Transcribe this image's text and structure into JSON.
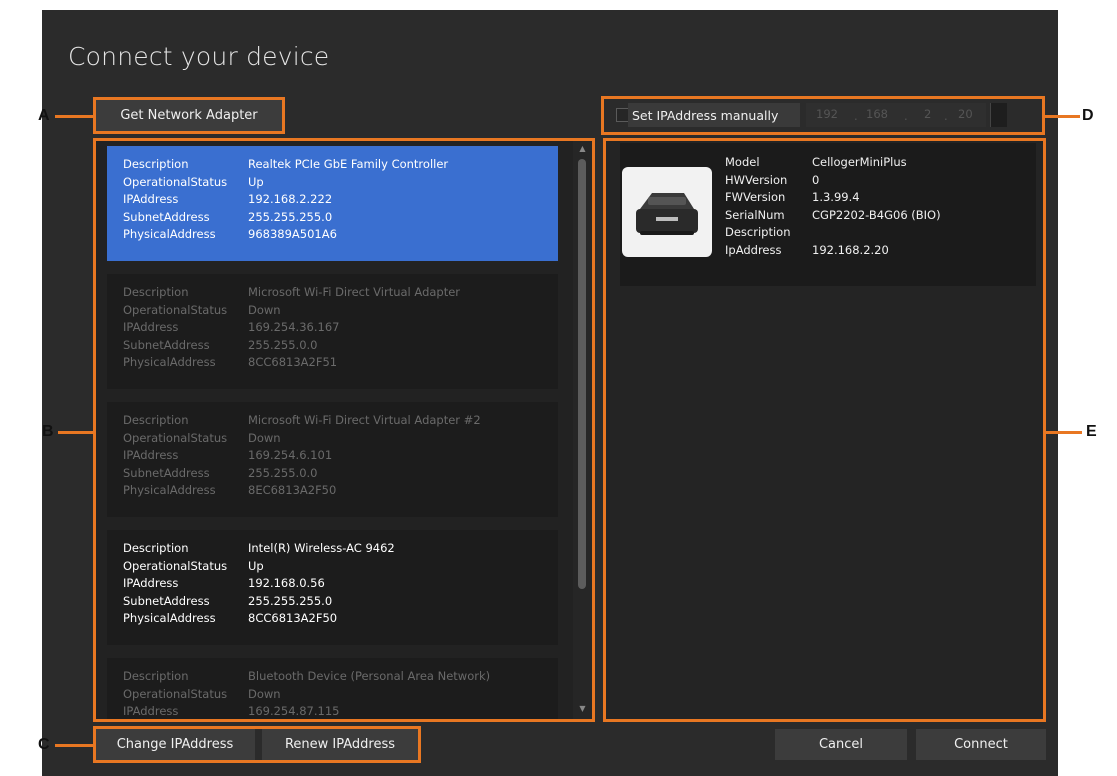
{
  "dialog": {
    "title": "Connect your device"
  },
  "buttons": {
    "get_network_adapter": "Get Network Adapter",
    "change_ip": "Change IPAddress",
    "renew_ip": "Renew IPAddress",
    "cancel": "Cancel",
    "connect": "Connect"
  },
  "callouts": {
    "a": "A",
    "b": "B",
    "c": "C",
    "d": "D",
    "e": "E"
  },
  "adapters": [
    {
      "description": "Realtek PCIe GbE Family Controller",
      "status": "Up",
      "ip": "192.168.2.222",
      "subnet": "255.255.255.0",
      "mac": "968389A501A6",
      "state": "selected"
    },
    {
      "description": "Microsoft Wi-Fi Direct Virtual Adapter",
      "status": "Down",
      "ip": "169.254.36.167",
      "subnet": "255.255.0.0",
      "mac": "8CC6813A2F51",
      "state": "dim"
    },
    {
      "description": "Microsoft Wi-Fi Direct Virtual Adapter #2",
      "status": "Down",
      "ip": "169.254.6.101",
      "subnet": "255.255.0.0",
      "mac": "8EC6813A2F50",
      "state": "dim"
    },
    {
      "description": "Intel(R) Wireless-AC 9462",
      "status": "Up",
      "ip": "192.168.0.56",
      "subnet": "255.255.255.0",
      "mac": "8CC6813A2F50",
      "state": "bright"
    },
    {
      "description": "Bluetooth Device (Personal Area Network)",
      "status": "Down",
      "ip": "169.254.87.115",
      "subnet": "",
      "mac": "",
      "state": "dim"
    }
  ],
  "adapter_labels": {
    "description": "Description",
    "status": "OperationalStatus",
    "ip": "IPAddress",
    "subnet": "SubnetAddress",
    "mac": "PhysicalAddress"
  },
  "manual_ip": {
    "label": "Set IPAddress manually",
    "checked": false,
    "octets": [
      "192",
      "168",
      "2",
      "20"
    ]
  },
  "device": {
    "labels": {
      "model": "Model",
      "hw": "HWVersion",
      "fw": "FWVersion",
      "serial": "SerialNum",
      "desc": "Description",
      "ip": "IpAddress"
    },
    "model": "CellogerMiniPlus",
    "hw": "0",
    "fw": "1.3.99.4",
    "serial": "CGP2202-B4G06 (BIO)",
    "desc": "",
    "ip": "192.168.2.20",
    "icon": "device-image"
  },
  "colors": {
    "accent": "#e87722",
    "selected": "#3a6fd0"
  }
}
